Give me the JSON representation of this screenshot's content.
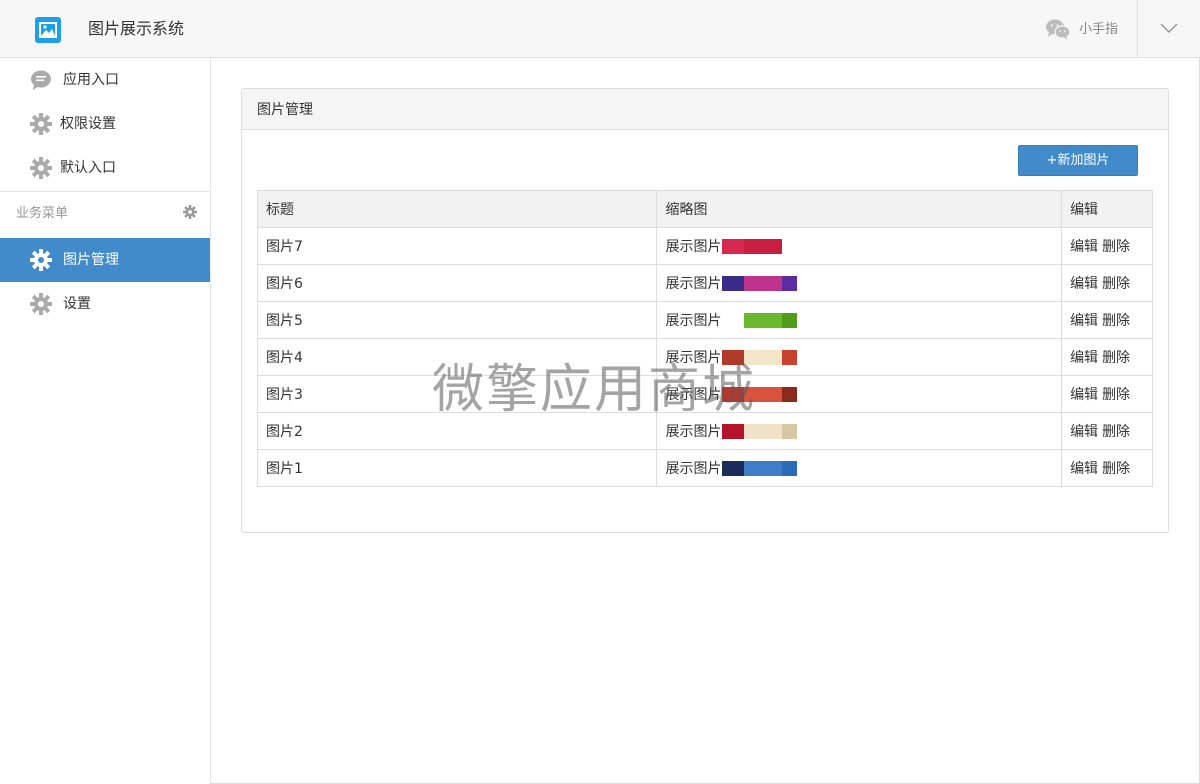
{
  "header": {
    "app_title": "图片展示系统",
    "user_name": "小手指"
  },
  "sidebar": {
    "items": [
      {
        "label": "应用入口",
        "icon": "chat-bubble-icon"
      },
      {
        "label": "权限设置",
        "icon": "gear-icon"
      },
      {
        "label": "默认入口",
        "icon": "gear-icon"
      }
    ],
    "group_title": "业务菜单",
    "group_items": [
      {
        "label": "图片管理",
        "icon": "gear-icon",
        "active": true
      },
      {
        "label": "设置",
        "icon": "gear-icon",
        "active": false
      }
    ]
  },
  "panel": {
    "title": "图片管理",
    "add_button": "+新加图片",
    "columns": [
      "标题",
      "缩略图",
      "编辑"
    ],
    "rows": [
      {
        "title": "图片7",
        "thumb_text": "展示图片",
        "edit": "编辑",
        "delete": "删除",
        "thumb_colors": [
          "#d9284d",
          "#c81e3f",
          "#ffffff"
        ]
      },
      {
        "title": "图片6",
        "thumb_text": "展示图片",
        "edit": "编辑",
        "delete": "删除",
        "thumb_colors": [
          "#3a2a8a",
          "#c0338c",
          "#5a2da0"
        ]
      },
      {
        "title": "图片5",
        "thumb_text": "展示图片",
        "edit": "编辑",
        "delete": "删除",
        "thumb_colors": [
          "#ffffff",
          "#6ab82c",
          "#4f9e1a"
        ]
      },
      {
        "title": "图片4",
        "thumb_text": "展示图片",
        "edit": "编辑",
        "delete": "删除",
        "thumb_colors": [
          "#b23a2a",
          "#f3e6c8",
          "#c8432e"
        ]
      },
      {
        "title": "图片3",
        "thumb_text": "展示图片",
        "edit": "编辑",
        "delete": "删除",
        "thumb_colors": [
          "#b8362c",
          "#d9523c",
          "#8a2a1c"
        ]
      },
      {
        "title": "图片2",
        "thumb_text": "展示图片",
        "edit": "编辑",
        "delete": "删除",
        "thumb_colors": [
          "#b3122a",
          "#efe2c9",
          "#d9c7a4"
        ]
      },
      {
        "title": "图片1",
        "thumb_text": "展示图片",
        "edit": "编辑",
        "delete": "删除",
        "thumb_colors": [
          "#1a2c5a",
          "#3f7dc8",
          "#2a6cb8"
        ]
      }
    ]
  },
  "watermark": "微擎应用商城",
  "colors": {
    "accent": "#428bca",
    "logo": "#1e9fe6"
  }
}
